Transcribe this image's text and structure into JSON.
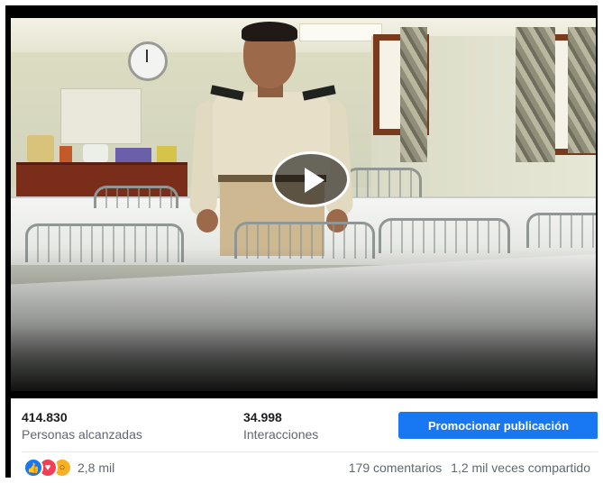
{
  "video": {
    "play_icon": "play-icon"
  },
  "insights": {
    "reached_value": "414.830",
    "reached_label": "Personas alcanzadas",
    "engagement_value": "34.998",
    "engagement_label": "Interacciones"
  },
  "promote": {
    "label": "Promocionar publicación",
    "color": "#1877f2"
  },
  "reactions": {
    "icons": [
      "like-icon",
      "love-icon",
      "wow-icon"
    ],
    "count": "2,8 mil"
  },
  "meta": {
    "comments": "179 comentarios",
    "shares": "1,2 mil veces compartido"
  }
}
